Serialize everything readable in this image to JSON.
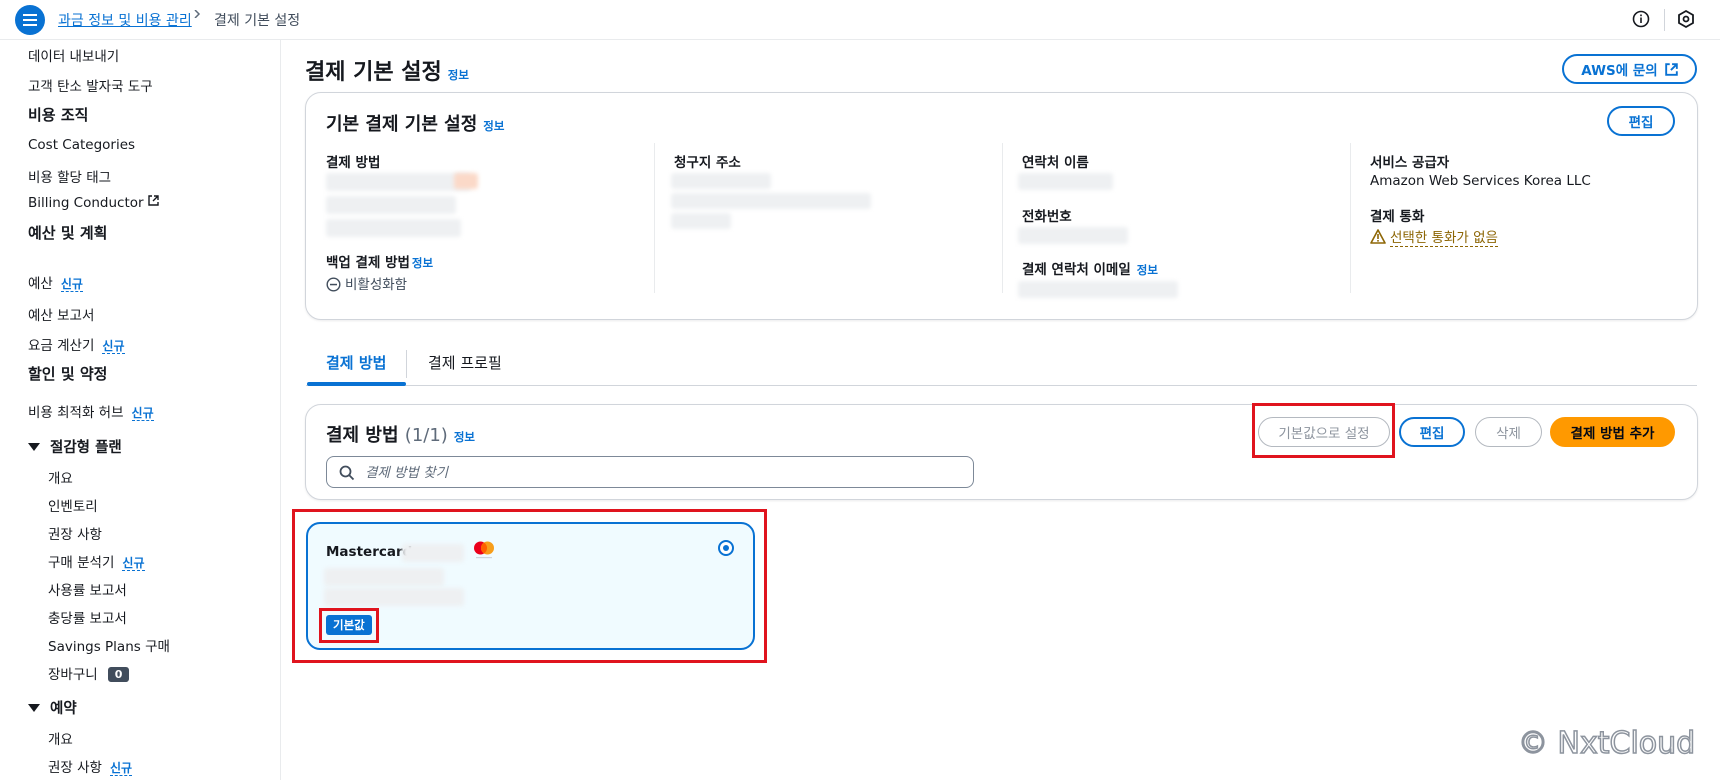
{
  "topbar": {
    "breadcrumb_link": "과금 정보 및 비용 관리",
    "breadcrumb_current": "결제 기본 설정"
  },
  "sidebar": {
    "items": [
      {
        "label": "데이터 내보내기"
      },
      {
        "label": "고객 탄소 발자국 도구"
      },
      {
        "label": "비용 조직"
      },
      {
        "label": "Cost Categories"
      },
      {
        "label": "비용 할당 태그"
      },
      {
        "label": "Billing Conductor"
      },
      {
        "label": "예산 및 계획"
      },
      {
        "label": "예산",
        "tag": "신규"
      },
      {
        "label": "예산 보고서"
      },
      {
        "label": "요금 계산기",
        "tag": "신규"
      },
      {
        "label": "할인 및 약정"
      },
      {
        "label": "비용 최적화 허브",
        "tag": "신규"
      },
      {
        "label": "절감형 플랜"
      },
      {
        "label": "개요"
      },
      {
        "label": "인벤토리"
      },
      {
        "label": "권장 사항"
      },
      {
        "label": "구매 분석기",
        "tag": "신규"
      },
      {
        "label": "사용률 보고서"
      },
      {
        "label": "충당률 보고서"
      },
      {
        "label": "Savings Plans 구매"
      },
      {
        "label": "장바구니",
        "count": "0"
      },
      {
        "label": "예약"
      },
      {
        "label": "개요"
      },
      {
        "label": "권장 사항",
        "tag": "신규"
      }
    ]
  },
  "page": {
    "title": "결제 기본 설정",
    "info": "정보",
    "contact_button": "AWS에 문의"
  },
  "default_panel": {
    "title": "기본 결제 기본 설정",
    "info": "정보",
    "edit_button": "편집",
    "payment_method_label": "결제 방법",
    "backup_label": "백업 결제 방법",
    "backup_info": "정보",
    "backup_value": "비활성화함",
    "billing_address_label": "청구지 주소",
    "contact_name_label": "연락처 이름",
    "phone_label": "전화번호",
    "billing_email_label": "결제 연락처 이메일",
    "billing_email_info": "정보",
    "provider_label": "서비스 공급자",
    "provider_value": "Amazon Web Services Korea LLC",
    "currency_label": "결제 통화",
    "currency_value": "선택한 통화가 없음"
  },
  "tabs": [
    {
      "label": "결제 방법"
    },
    {
      "label": "결제 프로필"
    }
  ],
  "methods_panel": {
    "title": "결제 방법",
    "count": "(1/1)",
    "info": "정보",
    "set_default_button": "기본값으로 설정",
    "edit_button": "편집",
    "delete_button": "삭제",
    "add_button": "결제 방법 추가",
    "search_placeholder": "결제 방법 찾기"
  },
  "card": {
    "brand": "Mastercard",
    "badge": "기본값"
  },
  "watermark": "© NxtCloud",
  "colors": {
    "accent": "#0972d3",
    "primary_button": "#ff9900",
    "highlight": "#e0141e",
    "warning": "#8d6605"
  }
}
